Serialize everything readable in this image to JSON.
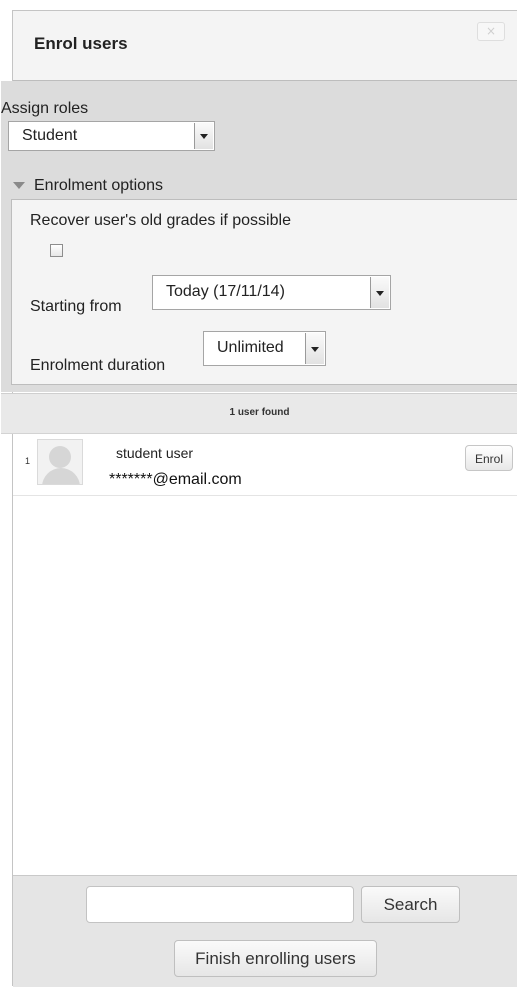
{
  "dialog": {
    "title": "Enrol users",
    "close_label": "×"
  },
  "assign_roles": {
    "label": "Assign roles",
    "selected": "Student"
  },
  "enrolment_options": {
    "toggle_label": "Enrolment options",
    "recover_label": "Recover user's old grades if possible",
    "recover_checked": false,
    "starting_from_label": "Starting from",
    "starting_from_value": "Today (17/11/14)",
    "duration_label": "Enrolment duration",
    "duration_value": "Unlimited"
  },
  "results": {
    "found_text": "1 user found",
    "users": [
      {
        "index": "1",
        "name": "student user",
        "email": "*******@email.com",
        "enrol_label": "Enrol"
      }
    ]
  },
  "footer": {
    "search_value": "",
    "search_label": "Search",
    "finish_label": "Finish enrolling users"
  }
}
